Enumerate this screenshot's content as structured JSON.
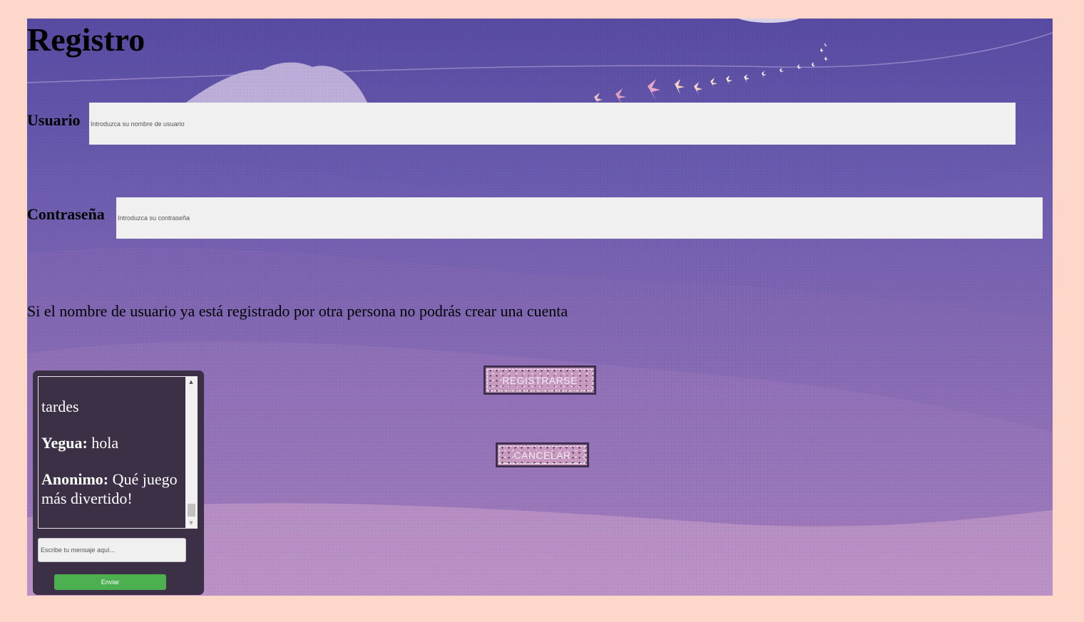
{
  "page": {
    "title": "Registro"
  },
  "form": {
    "user_label": "Usuario",
    "user_placeholder": "Introduzca su nombre de usuario",
    "password_label": "Contraseña",
    "password_placeholder": "Introduzca su contraseña",
    "note": "Si el nombre de usuario ya está registrado por otra persona no podrás crear una cuenta",
    "register_label": "REGISTRARSE",
    "cancel_label": "CANCELAR"
  },
  "chat": {
    "messages": [
      {
        "user": "",
        "text": "tardes"
      },
      {
        "user": "Yegua:",
        "text": " hola"
      },
      {
        "user": "Anonimo:",
        "text": " Qué juego más divertido!"
      }
    ],
    "input_placeholder": "Escribe tu mensaje aquí...",
    "send_label": "Enviar"
  },
  "colors": {
    "page_background": "#fcd7ca",
    "send_button": "#4caf50",
    "chat_panel": "#3b3045"
  }
}
